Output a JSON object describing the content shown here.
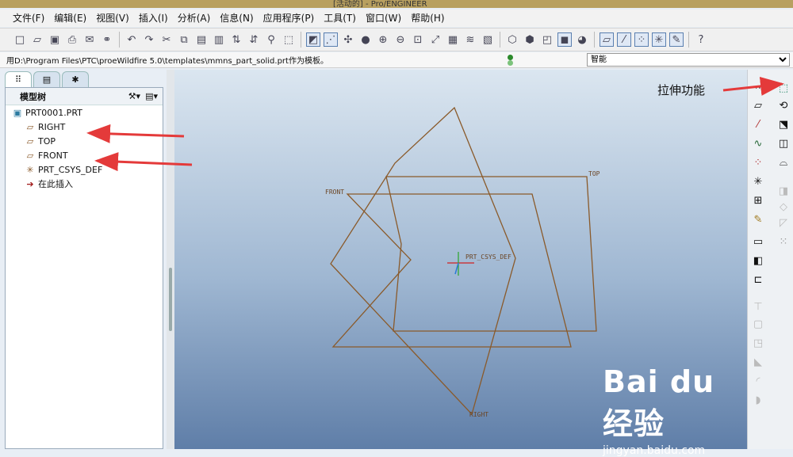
{
  "window": {
    "title": "[活动的] - Pro/ENGINEER"
  },
  "menu": [
    "文件(F)",
    "编辑(E)",
    "视图(V)",
    "插入(I)",
    "分析(A)",
    "信息(N)",
    "应用程序(P)",
    "工具(T)",
    "窗口(W)",
    "帮助(H)"
  ],
  "status": {
    "message": "用D:\\Program Files\\PTC\\proeWildfire 5.0\\templates\\mmns_part_solid.prt作为模板。",
    "filter_value": "智能"
  },
  "model_tree": {
    "title": "模型树",
    "items": [
      "PRT0001.PRT",
      "RIGHT",
      "TOP",
      "FRONT",
      "PRT_CSYS_DEF",
      "在此插入"
    ]
  },
  "viewport": {
    "labels": {
      "front": "FRONT",
      "top": "TOP",
      "right": "RIGHT",
      "csys": "PRT_CSYS_DEF"
    }
  },
  "annotation": {
    "text": "拉伸功能"
  },
  "watermark": {
    "brand": "Bai du 经验",
    "url": "jingyan.baidu.com"
  },
  "colors": {
    "datum": "#8a5a2a",
    "arrow": "#e43a3a",
    "viewport_top": "#dbe6f0",
    "viewport_bottom": "#5f7ea8"
  }
}
